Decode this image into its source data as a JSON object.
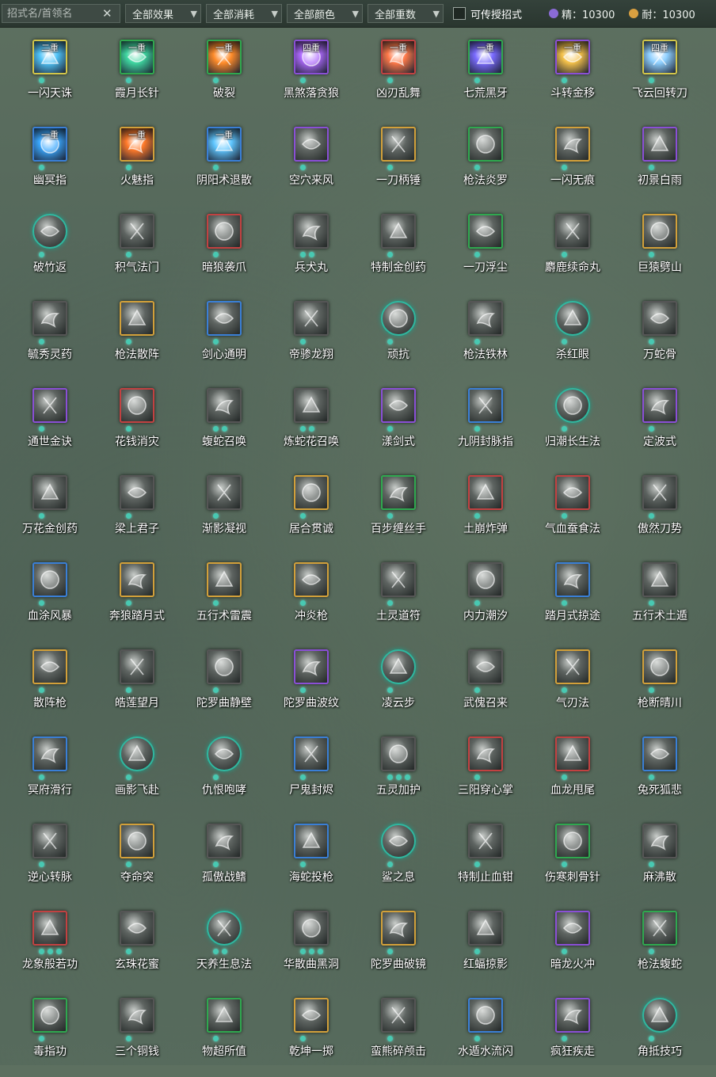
{
  "toolbar": {
    "search_placeholder": "招式名/首领名",
    "clear_glyph": "✕",
    "filters": [
      "全部效果",
      "全部消耗",
      "全部颜色",
      "全部重数"
    ],
    "checkbox_label": "可传授招式",
    "resources": [
      {
        "label": "精：10300",
        "color": "#8a6bd6"
      },
      {
        "label": "耐：10300",
        "color": "#d9a040"
      }
    ]
  },
  "skills": [
    [
      {
        "name": "一闪天诛",
        "tier": "二重",
        "color": "#d2c64a",
        "hue": "#4fc3f7",
        "dots": 1
      },
      {
        "name": "霞月长针",
        "tier": "一重",
        "color": "#2fa84f",
        "hue": "#3fd6a0",
        "dots": 1
      },
      {
        "name": "破裂",
        "tier": "一重",
        "color": "#2fa84f",
        "hue": "#ff8c2a",
        "dots": 1
      },
      {
        "name": "黑煞落贪狼",
        "tier": "四重",
        "color": "#8a4fd6",
        "hue": "#b06bff",
        "dots": 1
      },
      {
        "name": "凶刃乱舞",
        "tier": "一重",
        "color": "#c24141",
        "hue": "#ff7a4a",
        "dots": 1
      },
      {
        "name": "七荒黑牙",
        "tier": "一重",
        "color": "#2fa84f",
        "hue": "#7a6bff",
        "dots": 1
      },
      {
        "name": "斗转金移",
        "tier": "一重",
        "color": "#8a4fd6",
        "hue": "#f4c14a",
        "dots": 1
      },
      {
        "name": "飞云回转刀",
        "tier": "四重",
        "color": "#d2c64a",
        "hue": "#8fd0ff",
        "dots": 1
      }
    ],
    [
      {
        "name": "幽冥指",
        "tier": "一重",
        "color": "#3a7fd6",
        "hue": "#3aa8ff",
        "dots": 1
      },
      {
        "name": "火魅指",
        "tier": "一重",
        "color": "#d2a03a",
        "hue": "#ff7a2a",
        "dots": 1
      },
      {
        "name": "阴阳术退散",
        "tier": "一重",
        "color": "#3a7fd6",
        "hue": "#5fc6ff",
        "dots": 1
      },
      {
        "name": "空穴来风",
        "tier": "",
        "color": "#8a4fd6",
        "hue": "",
        "dots": 1
      },
      {
        "name": "一刀柄锤",
        "tier": "",
        "color": "#d2a03a",
        "hue": "",
        "dots": 1
      },
      {
        "name": "枪法炎罗",
        "tier": "",
        "color": "#2fa84f",
        "hue": "",
        "dots": 1
      },
      {
        "name": "一闪无痕",
        "tier": "",
        "color": "#d2a03a",
        "hue": "",
        "dots": 1
      },
      {
        "name": "初景白雨",
        "tier": "",
        "color": "#8a4fd6",
        "hue": "",
        "dots": 1
      }
    ],
    [
      {
        "name": "破竹返",
        "tier": "",
        "color": "round",
        "hue": "",
        "dots": 1
      },
      {
        "name": "积气法门",
        "tier": "",
        "color": "#555",
        "hue": "",
        "dots": 1
      },
      {
        "name": "暗狼袭爪",
        "tier": "",
        "color": "#c24141",
        "hue": "",
        "dots": 1
      },
      {
        "name": "兵犬丸",
        "tier": "",
        "color": "#555",
        "hue": "",
        "dots": 2
      },
      {
        "name": "特制金创药",
        "tier": "",
        "color": "#555",
        "hue": "",
        "dots": 1
      },
      {
        "name": "一刀浮尘",
        "tier": "",
        "color": "#2fa84f",
        "hue": "",
        "dots": 1
      },
      {
        "name": "麝鹿续命丸",
        "tier": "",
        "color": "#555",
        "hue": "",
        "dots": 1
      },
      {
        "name": "巨猿劈山",
        "tier": "",
        "color": "#d2a03a",
        "hue": "",
        "dots": 1
      }
    ],
    [
      {
        "name": "毓秀灵药",
        "tier": "",
        "color": "#555",
        "hue": "",
        "dots": 1
      },
      {
        "name": "枪法散阵",
        "tier": "",
        "color": "#d2a03a",
        "hue": "",
        "dots": 1
      },
      {
        "name": "剑心通明",
        "tier": "",
        "color": "#3a7fd6",
        "hue": "",
        "dots": 1
      },
      {
        "name": "帝骖龙翔",
        "tier": "",
        "color": "#555",
        "hue": "",
        "dots": 1
      },
      {
        "name": "顽抗",
        "tier": "",
        "color": "round",
        "hue": "",
        "dots": 1
      },
      {
        "name": "枪法铁林",
        "tier": "",
        "color": "#555",
        "hue": "",
        "dots": 1
      },
      {
        "name": "杀红眼",
        "tier": "",
        "color": "round",
        "hue": "",
        "dots": 1
      },
      {
        "name": "万蛇骨",
        "tier": "",
        "color": "#555",
        "hue": "",
        "dots": 1
      }
    ],
    [
      {
        "name": "通世金诀",
        "tier": "",
        "color": "#8a4fd6",
        "hue": "",
        "dots": 1
      },
      {
        "name": "花钱消灾",
        "tier": "",
        "color": "#c24141",
        "hue": "",
        "dots": 1
      },
      {
        "name": "蝮蛇召唤",
        "tier": "",
        "color": "#555",
        "hue": "",
        "dots": 2
      },
      {
        "name": "炼蛇花召唤",
        "tier": "",
        "color": "#555",
        "hue": "",
        "dots": 2
      },
      {
        "name": "漾剑式",
        "tier": "",
        "color": "#8a4fd6",
        "hue": "",
        "dots": 1
      },
      {
        "name": "九阴封脉指",
        "tier": "",
        "color": "#3a7fd6",
        "hue": "",
        "dots": 1
      },
      {
        "name": "归潮长生法",
        "tier": "",
        "color": "round",
        "hue": "",
        "dots": 1
      },
      {
        "name": "定波式",
        "tier": "",
        "color": "#8a4fd6",
        "hue": "",
        "dots": 1
      }
    ],
    [
      {
        "name": "万花金创药",
        "tier": "",
        "color": "#555",
        "hue": "",
        "dots": 1
      },
      {
        "name": "梁上君子",
        "tier": "",
        "color": "#555",
        "hue": "",
        "dots": 1
      },
      {
        "name": "渐影凝视",
        "tier": "",
        "color": "#555",
        "hue": "",
        "dots": 1
      },
      {
        "name": "居合贯诚",
        "tier": "",
        "color": "#d2a03a",
        "hue": "",
        "dots": 1
      },
      {
        "name": "百步缠丝手",
        "tier": "",
        "color": "#2fa84f",
        "hue": "",
        "dots": 1
      },
      {
        "name": "土崩炸弹",
        "tier": "",
        "color": "#c24141",
        "hue": "",
        "dots": 1
      },
      {
        "name": "气血蚕食法",
        "tier": "",
        "color": "#c24141",
        "hue": "",
        "dots": 1
      },
      {
        "name": "傲然刀势",
        "tier": "",
        "color": "#555",
        "hue": "",
        "dots": 1
      }
    ],
    [
      {
        "name": "血涂风暴",
        "tier": "",
        "color": "#3a7fd6",
        "hue": "",
        "dots": 1
      },
      {
        "name": "奔狼踏月式",
        "tier": "",
        "color": "#d2a03a",
        "hue": "",
        "dots": 1
      },
      {
        "name": "五行术雷震",
        "tier": "",
        "color": "#d2a03a",
        "hue": "",
        "dots": 1
      },
      {
        "name": "冲炎枪",
        "tier": "",
        "color": "#d2a03a",
        "hue": "",
        "dots": 1
      },
      {
        "name": "土灵道符",
        "tier": "",
        "color": "#555",
        "hue": "",
        "dots": 1
      },
      {
        "name": "内力潮汐",
        "tier": "",
        "color": "#555",
        "hue": "",
        "dots": 1
      },
      {
        "name": "踏月式掠途",
        "tier": "",
        "color": "#3a7fd6",
        "hue": "",
        "dots": 1
      },
      {
        "name": "五行术土遁",
        "tier": "",
        "color": "#555",
        "hue": "",
        "dots": 1
      }
    ],
    [
      {
        "name": "散阵枪",
        "tier": "",
        "color": "#d2a03a",
        "hue": "",
        "dots": 1
      },
      {
        "name": "皓莲望月",
        "tier": "",
        "color": "#555",
        "hue": "",
        "dots": 1
      },
      {
        "name": "陀罗曲静壁",
        "tier": "",
        "color": "#555",
        "hue": "",
        "dots": 1
      },
      {
        "name": "陀罗曲波纹",
        "tier": "",
        "color": "#8a4fd6",
        "hue": "",
        "dots": 1
      },
      {
        "name": "凌云步",
        "tier": "",
        "color": "round",
        "hue": "",
        "dots": 1
      },
      {
        "name": "武傀召来",
        "tier": "",
        "color": "#555",
        "hue": "",
        "dots": 1
      },
      {
        "name": "气刃法",
        "tier": "",
        "color": "#d2a03a",
        "hue": "",
        "dots": 1
      },
      {
        "name": "枪断晴川",
        "tier": "",
        "color": "#d2a03a",
        "hue": "",
        "dots": 1
      }
    ],
    [
      {
        "name": "冥府滑行",
        "tier": "",
        "color": "#3a7fd6",
        "hue": "",
        "dots": 1
      },
      {
        "name": "画影飞赴",
        "tier": "",
        "color": "round",
        "hue": "",
        "dots": 1
      },
      {
        "name": "仇恨咆哮",
        "tier": "",
        "color": "round",
        "hue": "",
        "dots": 1
      },
      {
        "name": "尸鬼封烬",
        "tier": "",
        "color": "#3a7fd6",
        "hue": "",
        "dots": 1
      },
      {
        "name": "五灵加护",
        "tier": "",
        "color": "#555",
        "hue": "",
        "dots": 3
      },
      {
        "name": "三阳穿心掌",
        "tier": "",
        "color": "#c24141",
        "hue": "",
        "dots": 1
      },
      {
        "name": "血龙甩尾",
        "tier": "",
        "color": "#c24141",
        "hue": "",
        "dots": 1
      },
      {
        "name": "兔死狐悲",
        "tier": "",
        "color": "#3a7fd6",
        "hue": "",
        "dots": 1
      }
    ],
    [
      {
        "name": "逆心转脉",
        "tier": "",
        "color": "#555",
        "hue": "",
        "dots": 1
      },
      {
        "name": "夺命突",
        "tier": "",
        "color": "#d2a03a",
        "hue": "",
        "dots": 1
      },
      {
        "name": "孤傲战鳍",
        "tier": "",
        "color": "#555",
        "hue": "",
        "dots": 1
      },
      {
        "name": "海蛇投枪",
        "tier": "",
        "color": "#3a7fd6",
        "hue": "",
        "dots": 1
      },
      {
        "name": "鲨之息",
        "tier": "",
        "color": "round",
        "hue": "",
        "dots": 1
      },
      {
        "name": "特制止血钳",
        "tier": "",
        "color": "#555",
        "hue": "",
        "dots": 1
      },
      {
        "name": "伤寒刺骨针",
        "tier": "",
        "color": "#2fa84f",
        "hue": "",
        "dots": 1
      },
      {
        "name": "麻沸散",
        "tier": "",
        "color": "#555",
        "hue": "",
        "dots": 1
      }
    ],
    [
      {
        "name": "龙象般若功",
        "tier": "",
        "color": "#c24141",
        "hue": "",
        "dots": 3
      },
      {
        "name": "玄珠花蜜",
        "tier": "",
        "color": "#555",
        "hue": "",
        "dots": 1
      },
      {
        "name": "天养生息法",
        "tier": "",
        "color": "round",
        "hue": "",
        "dots": 2
      },
      {
        "name": "华散曲黑洞",
        "tier": "",
        "color": "#555",
        "hue": "",
        "dots": 3
      },
      {
        "name": "陀罗曲破镜",
        "tier": "",
        "color": "#d2a03a",
        "hue": "",
        "dots": 1
      },
      {
        "name": "红蝠掠影",
        "tier": "",
        "color": "#555",
        "hue": "",
        "dots": 1
      },
      {
        "name": "暗龙火冲",
        "tier": "",
        "color": "#8a4fd6",
        "hue": "",
        "dots": 1
      },
      {
        "name": "枪法蝮蛇",
        "tier": "",
        "color": "#2fa84f",
        "hue": "",
        "dots": 1
      }
    ],
    [
      {
        "name": "毒指功",
        "tier": "",
        "color": "#2fa84f",
        "hue": "",
        "dots": 1
      },
      {
        "name": "三个铜钱",
        "tier": "",
        "color": "#555",
        "hue": "",
        "dots": 1
      },
      {
        "name": "物超所值",
        "tier": "",
        "color": "#2fa84f",
        "hue": "",
        "dots": 1
      },
      {
        "name": "乾坤一掷",
        "tier": "",
        "color": "#d2a03a",
        "hue": "",
        "dots": 1
      },
      {
        "name": "蛮熊碎颅击",
        "tier": "",
        "color": "#555",
        "hue": "",
        "dots": 1
      },
      {
        "name": "水遁水流闪",
        "tier": "",
        "color": "#3a7fd6",
        "hue": "",
        "dots": 1
      },
      {
        "name": "疯狂疾走",
        "tier": "",
        "color": "#8a4fd6",
        "hue": "",
        "dots": 1
      },
      {
        "name": "角抵技巧",
        "tier": "",
        "color": "round",
        "hue": "",
        "dots": 1
      }
    ]
  ]
}
